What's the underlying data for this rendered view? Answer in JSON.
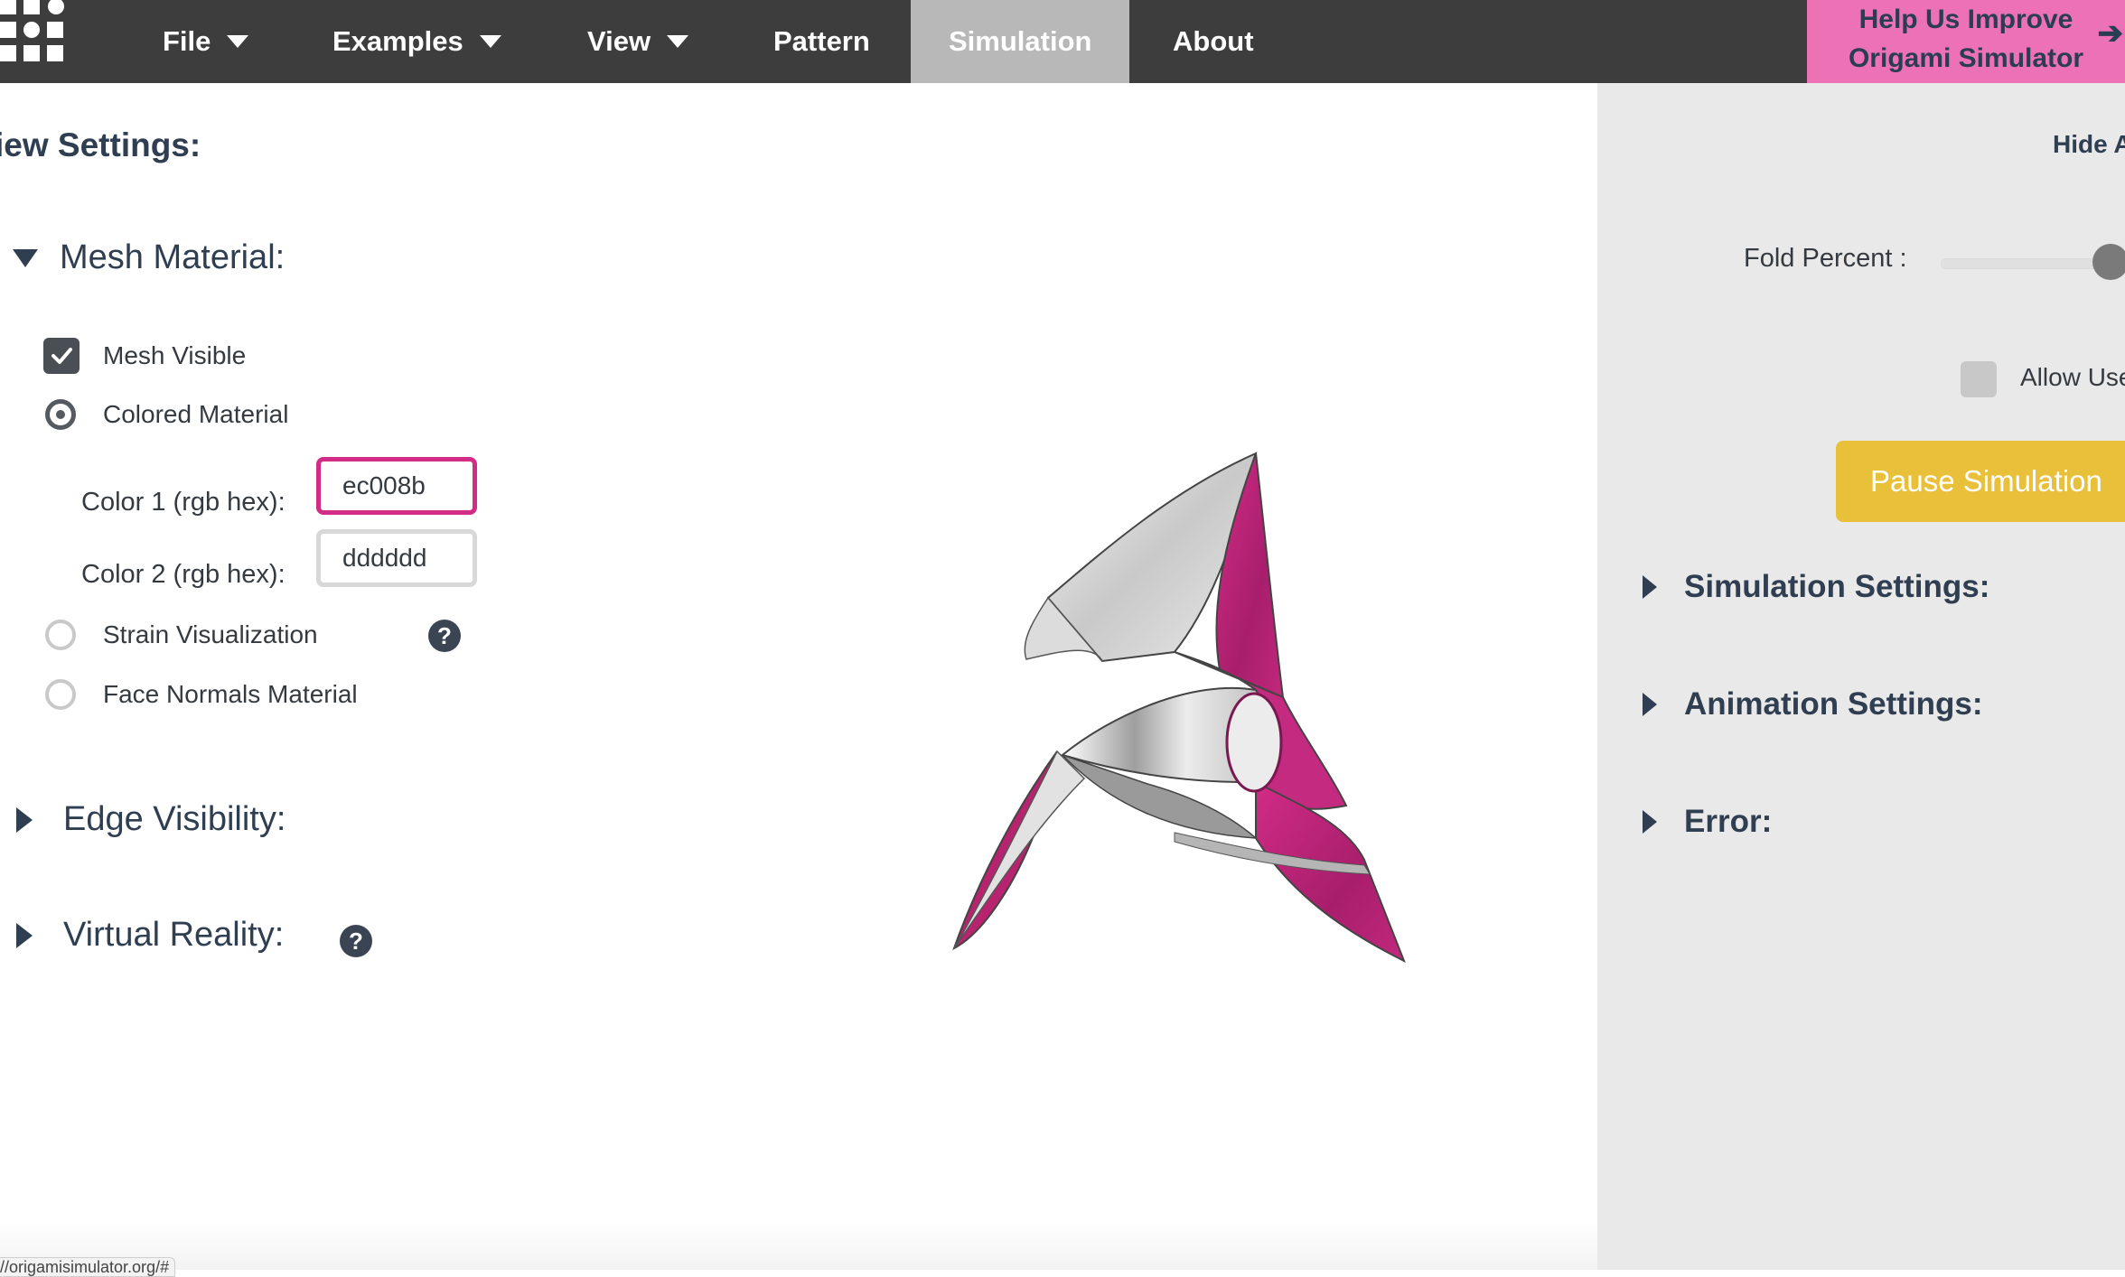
{
  "nav": {
    "items": [
      {
        "label": "File",
        "dropdown": true
      },
      {
        "label": "Examples",
        "dropdown": true
      },
      {
        "label": "View",
        "dropdown": true
      },
      {
        "label": "Pattern",
        "dropdown": false
      },
      {
        "label": "Simulation",
        "dropdown": false,
        "active": true
      },
      {
        "label": "About",
        "dropdown": false
      }
    ],
    "banner_line1": "Help Us Improve",
    "banner_line2": "Origami Simulator",
    "banner_icon": "arrow-right-icon"
  },
  "left_panel": {
    "title": "iew Settings:",
    "mesh_material": {
      "heading": "Mesh Material:",
      "expanded": true,
      "mesh_visible_label": "Mesh Visible",
      "mesh_visible_checked": true,
      "colored_material_label": "Colored Material",
      "colored_material_selected": true,
      "color1_label": "Color 1 (rgb hex):",
      "color1_value": "ec008b",
      "color2_label": "Color 2 (rgb hex):",
      "color2_value": "dddddd",
      "strain_label": "Strain Visualization",
      "face_normals_label": "Face Normals Material"
    },
    "edge_visibility_heading": "Edge Visibility:",
    "virtual_reality_heading": "Virtual Reality:",
    "help_glyph": "?"
  },
  "right_panel": {
    "hide_link": "Hide A",
    "fold_percent_label": "Fold Percent :",
    "fold_percent_value": 1.0,
    "allow_label": "Allow Use",
    "allow_checked": false,
    "pause_button": "Pause Simulation",
    "sections": [
      "Simulation Settings:",
      "Animation Settings:",
      "Error:"
    ]
  },
  "status_bar": {
    "url": "//origamisimulator.org/#"
  },
  "colors": {
    "nav_bg": "#3d3d3d",
    "nav_active_bg": "#b8b8b8",
    "banner_bg": "#ec72b5",
    "model_primary": "#ec008b",
    "model_secondary": "#dddddd",
    "pause_button_bg": "#e8c03a",
    "right_panel_bg": "#e9e9e9"
  }
}
